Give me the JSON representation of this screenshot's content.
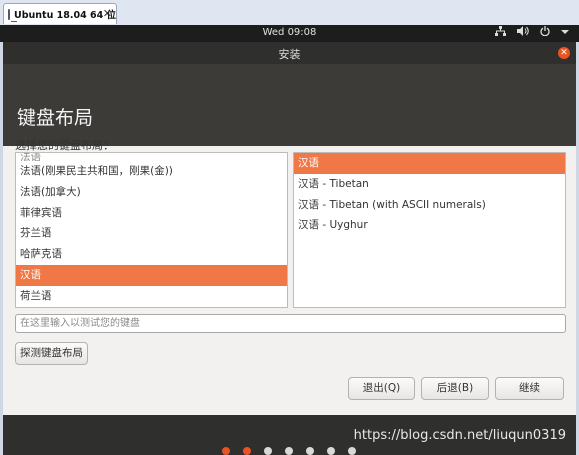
{
  "host": {
    "tab_label": "Ubuntu 18.04 64 位",
    "close": "✕"
  },
  "panel": {
    "clock": "Wed 09:08",
    "network_icon": "network-icon",
    "volume_icon": "volume-icon",
    "power_icon": "power-icon"
  },
  "window": {
    "title": "安装"
  },
  "page": {
    "heading": "键盘布局",
    "prompt": "选择您的键盘布局："
  },
  "layouts": {
    "partial_top": "法语",
    "items": [
      {
        "label": "法语(刚果民主共和国，刚果(金))",
        "selected": false
      },
      {
        "label": "法语(加拿大)",
        "selected": false
      },
      {
        "label": "菲律宾语",
        "selected": false
      },
      {
        "label": "芬兰语",
        "selected": false
      },
      {
        "label": "哈萨克语",
        "selected": false
      },
      {
        "label": "汉语",
        "selected": true
      },
      {
        "label": "荷兰语",
        "selected": false
      }
    ]
  },
  "variants": [
    {
      "label": "汉语",
      "selected": true
    },
    {
      "label": "汉语 - Tibetan",
      "selected": false
    },
    {
      "label": "汉语 - Tibetan (with ASCII numerals)",
      "selected": false
    },
    {
      "label": "汉语 - Uyghur",
      "selected": false
    }
  ],
  "test_input": {
    "placeholder": "在这里输入以测试您的键盘",
    "value": ""
  },
  "buttons": {
    "detect": "探测键盘布局",
    "quit": "退出(Q)",
    "back": "后退(B)",
    "next": "继续"
  },
  "progress": {
    "total_steps": 7,
    "completed_steps": 2
  },
  "watermark": "https://blog.csdn.net/liuqun0319",
  "colors": {
    "accent": "#e95420",
    "selection": "#f07746",
    "panel": "#1d1d1d",
    "header": "#3c3b37"
  }
}
